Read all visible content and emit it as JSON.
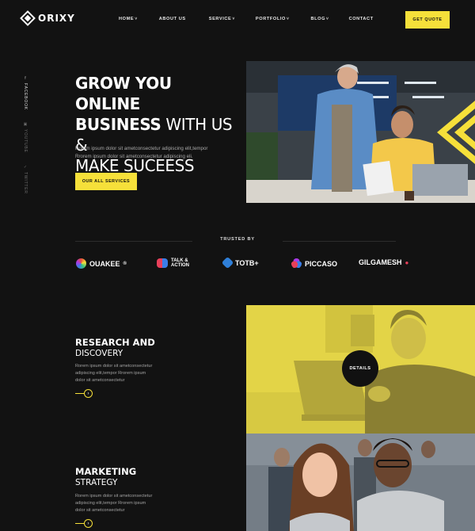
{
  "header": {
    "logo_text": "ORIXY",
    "nav": [
      {
        "label": "HOME",
        "has_dropdown": true
      },
      {
        "label": "ABOUT US",
        "has_dropdown": false
      },
      {
        "label": "SERVICE",
        "has_dropdown": true
      },
      {
        "label": "PORTFOLIO",
        "has_dropdown": true
      },
      {
        "label": "BLOG",
        "has_dropdown": true
      },
      {
        "label": "CONTACT",
        "has_dropdown": false
      }
    ],
    "quote_button": "GET QUOTE"
  },
  "social": [
    {
      "label": "FACEBOOK",
      "icon": "facebook-icon"
    },
    {
      "label": "YOUTUBE",
      "icon": "youtube-icon"
    },
    {
      "label": "TWITTER",
      "icon": "twitter-icon"
    }
  ],
  "hero": {
    "title_line1": "GROW YOU ONLINE",
    "title_line2_bold": "BUSINESS",
    "title_line2_light": " WITH US &",
    "title_line3": "MAKE SUCEESS",
    "text": "Rorem ipsum dolor sit ametconsectetur adipiscing elit,tempor Rrorem ipsum dolor sit ametconsectetur adipiscing eli.",
    "button": "OUR ALL SERVICES"
  },
  "trusted": {
    "label": "TRUSTED BY",
    "brands": [
      "OUAKEE",
      "TALK & ACTION",
      "TOTB+",
      "PICCASO",
      "GILGAMESH"
    ]
  },
  "sections": [
    {
      "title_bold": "RESEARCH AND",
      "title_light": "DISCOVERY",
      "text": "Rorem ipsum dolor sit ametconsectetur adipiscing elit,tempor Rrorem ipsum dolor sit ametconsectetur",
      "details_label": "DETAILS"
    },
    {
      "title_bold": "MARKETING",
      "title_light": "STRATEGY",
      "text": "Rorem ipsum dolor sit ametconsectetur adipiscing elit,tempor Rrorem ipsum dolor sit ametconsectetur"
    }
  ],
  "colors": {
    "accent": "#f6e03a",
    "background": "#121212"
  }
}
